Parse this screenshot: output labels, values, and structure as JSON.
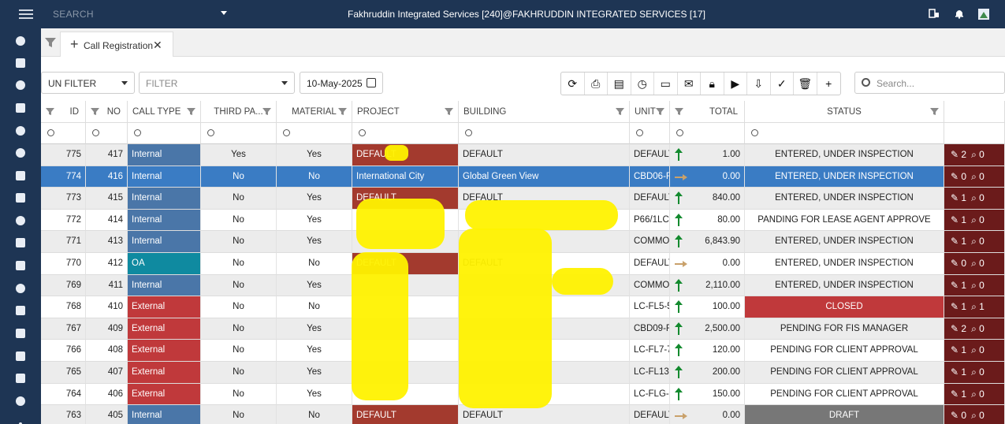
{
  "header": {
    "search_placeholder": "SEARCH",
    "title": "Fakhruddin Integrated Services [240]@FAKHRUDDIN INTEGRATED SERVICES [17]",
    "icons": [
      "menu-icon",
      "building-switch-icon",
      "bell-icon",
      "user-avatar-icon"
    ]
  },
  "sidebar": {
    "items": [
      "dashboard-icon",
      "inbox-icon",
      "users-icon",
      "list-icon",
      "globe-icon",
      "target-icon",
      "building-icon",
      "phone-icon",
      "people-icon",
      "table-icon",
      "cart-icon",
      "gear-icon",
      "edit-icon",
      "card-icon",
      "document-icon",
      "id-card-icon",
      "circle-icon",
      "more-icon"
    ]
  },
  "tabs": [
    {
      "label": "Call Registration"
    }
  ],
  "toolbar": {
    "un_filter": "UN FILTER",
    "filter_placeholder": "FILTER",
    "date": "10-May-2025",
    "search_placeholder": "Search...",
    "buttons": [
      "refresh-icon",
      "print-icon",
      "export-icon",
      "history-icon",
      "comment-icon",
      "mail-icon",
      "lock-icon",
      "play-icon",
      "download-icon",
      "check-icon",
      "trash-icon",
      "plus-icon"
    ]
  },
  "grid": {
    "columns": [
      "ID",
      "NO",
      "CALL TYPE",
      "THIRD PA...",
      "MATERIAL",
      "PROJECT",
      "BUILDING",
      "UNIT",
      "TOTAL",
      "STATUS",
      ""
    ],
    "rows": [
      {
        "id": "775",
        "no": "417",
        "type": "Internal",
        "third": "Yes",
        "material": "Yes",
        "project": "DEFAULT",
        "building": "DEFAULT",
        "unit": "DEFAULT",
        "trend": "up",
        "total": "1.00",
        "status": "ENTERED, UNDER INSPECTION",
        "edits": "2",
        "attach": "0"
      },
      {
        "id": "774",
        "no": "416",
        "type": "Internal",
        "third": "No",
        "material": "No",
        "project": "International City",
        "building": "Global Green View",
        "unit": "CBD06-F(",
        "trend": "right",
        "total": "0.00",
        "status": "ENTERED, UNDER INSPECTION",
        "edits": "0",
        "attach": "0",
        "selected": true
      },
      {
        "id": "773",
        "no": "415",
        "type": "Internal",
        "third": "No",
        "material": "Yes",
        "project": "DEFAULT",
        "building": "DEFAULT",
        "unit": "DEFAULT",
        "trend": "up",
        "total": "840.00",
        "status": "ENTERED, UNDER INSPECTION",
        "edits": "1",
        "attach": "0"
      },
      {
        "id": "772",
        "no": "414",
        "type": "Internal",
        "third": "No",
        "material": "Yes",
        "project": "",
        "building": "",
        "unit": "P66/1LCE",
        "trend": "up",
        "total": "80.00",
        "status": "PANDING FOR LEASE AGENT APPROVE",
        "edits": "1",
        "attach": "0"
      },
      {
        "id": "771",
        "no": "413",
        "type": "Internal",
        "third": "No",
        "material": "Yes",
        "project": "",
        "building": "",
        "unit": "COMMO",
        "trend": "up",
        "total": "6,843.90",
        "status": "ENTERED, UNDER INSPECTION",
        "edits": "1",
        "attach": "0"
      },
      {
        "id": "770",
        "no": "412",
        "type": "OA",
        "third": "No",
        "material": "No",
        "project": "DEFAULT",
        "building": "DEFAULT",
        "unit": "DEFAULT",
        "trend": "right",
        "total": "0.00",
        "status": "ENTERED, UNDER INSPECTION",
        "edits": "0",
        "attach": "0"
      },
      {
        "id": "769",
        "no": "411",
        "type": "Internal",
        "third": "No",
        "material": "Yes",
        "project": "",
        "building": "",
        "unit": "COMMO",
        "trend": "up",
        "total": "2,110.00",
        "status": "ENTERED, UNDER INSPECTION",
        "edits": "1",
        "attach": "0"
      },
      {
        "id": "768",
        "no": "410",
        "type": "External",
        "third": "No",
        "material": "No",
        "project": "",
        "building": "",
        "unit": "LC-FL5-5(",
        "trend": "up",
        "total": "100.00",
        "status": "CLOSED",
        "edits": "1",
        "attach": "1"
      },
      {
        "id": "767",
        "no": "409",
        "type": "External",
        "third": "No",
        "material": "Yes",
        "project": "",
        "building": "",
        "unit": "CBD09-FI",
        "trend": "up",
        "total": "2,500.00",
        "status": "PENDING FOR FIS MANAGER",
        "edits": "2",
        "attach": "0"
      },
      {
        "id": "766",
        "no": "408",
        "type": "External",
        "third": "No",
        "material": "Yes",
        "project": "",
        "building": "",
        "unit": "LC-FL7-7(",
        "trend": "up",
        "total": "120.00",
        "status": "PENDING FOR CLIENT APPROVAL",
        "edits": "1",
        "attach": "0"
      },
      {
        "id": "765",
        "no": "407",
        "type": "External",
        "third": "No",
        "material": "Yes",
        "project": "",
        "building": "",
        "unit": "LC-FL13-",
        "trend": "up",
        "total": "200.00",
        "status": "PENDING FOR CLIENT APPROVAL",
        "edits": "1",
        "attach": "0"
      },
      {
        "id": "764",
        "no": "406",
        "type": "External",
        "third": "No",
        "material": "Yes",
        "project": "",
        "building": "",
        "unit": "LC-FLG-G",
        "trend": "up",
        "total": "150.00",
        "status": "PENDING FOR CLIENT APPROVAL",
        "edits": "1",
        "attach": "0"
      },
      {
        "id": "763",
        "no": "405",
        "type": "Internal",
        "third": "No",
        "material": "No",
        "project": "DEFAULT",
        "building": "DEFAULT",
        "unit": "DEFAULT",
        "trend": "right",
        "total": "0.00",
        "status": "DRAFT",
        "edits": "0",
        "attach": "0"
      }
    ]
  }
}
